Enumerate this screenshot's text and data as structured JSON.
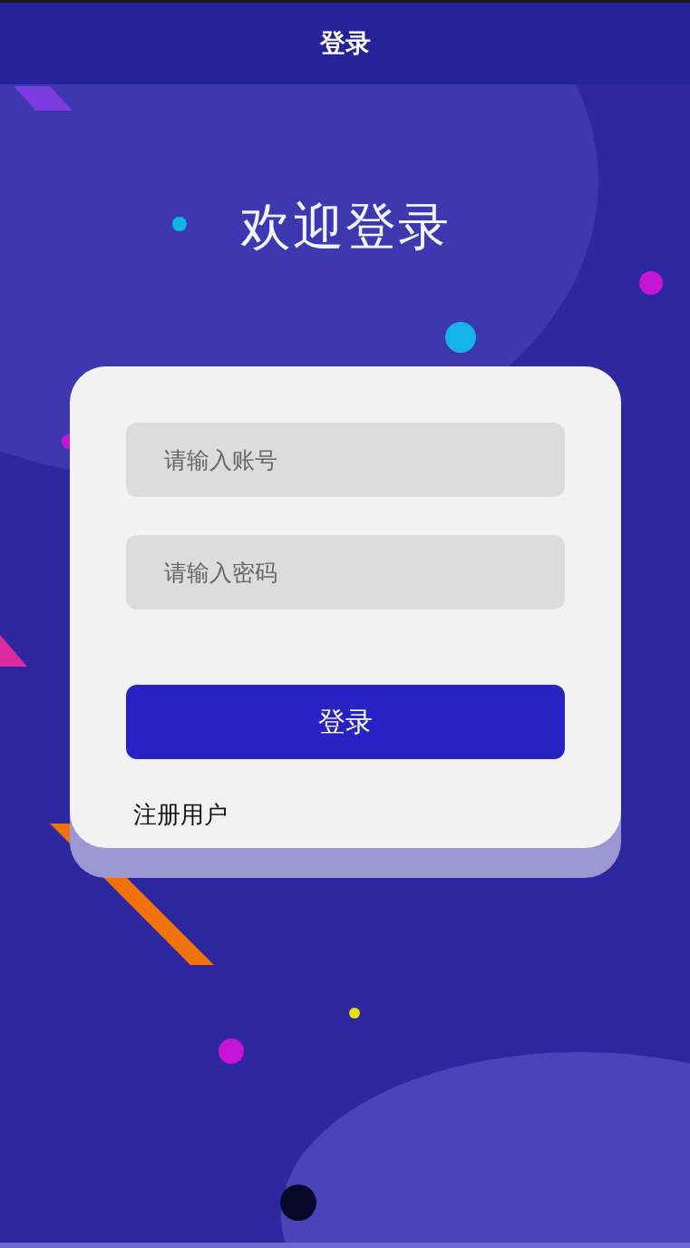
{
  "header": {
    "title": "登录"
  },
  "welcome": "欢迎登录",
  "form": {
    "fields": [
      {
        "placeholder": "请输入账号"
      },
      {
        "placeholder": "请输入密码"
      }
    ],
    "submit": "登录",
    "register_link": "注册用户"
  }
}
